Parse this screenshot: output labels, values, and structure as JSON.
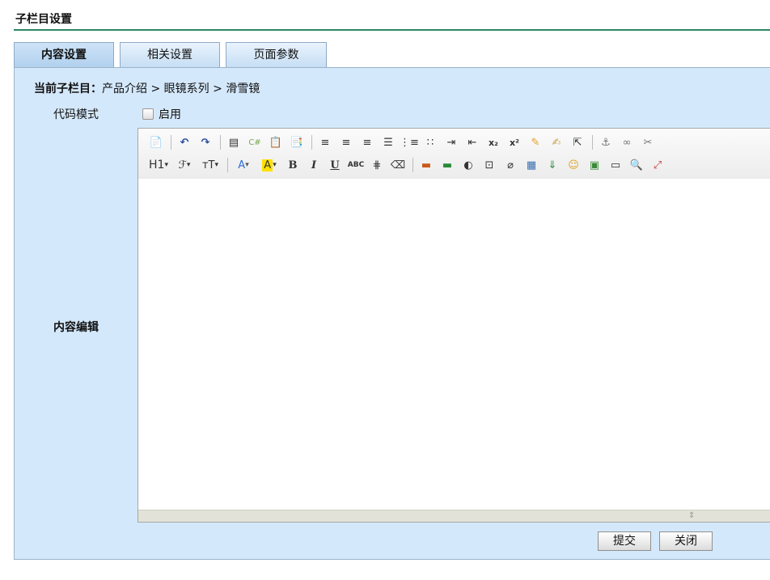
{
  "page": {
    "title": "子栏目设置"
  },
  "tabs": [
    {
      "label": "内容设置",
      "active": true
    },
    {
      "label": "相关设置",
      "active": false
    },
    {
      "label": "页面参数",
      "active": false
    }
  ],
  "breadcrumb": {
    "label": "当前子栏目：",
    "items": [
      "产品介绍",
      "眼镜系列",
      "滑雪镜"
    ],
    "separator": ">"
  },
  "code_mode": {
    "label": "代码模式",
    "checkbox_label": "启用",
    "checked": false
  },
  "content_editor": {
    "label": "内容编辑",
    "value": ""
  },
  "toolbar": {
    "row1": [
      "source",
      "undo",
      "redo",
      "|",
      "paste-text",
      "code",
      "paste",
      "paste-word",
      "|",
      "align-left",
      "align-center",
      "align-right",
      "justify",
      "ordered-list",
      "unordered-list",
      "indent",
      "outdent",
      "subscript",
      "superscript",
      "clear-format",
      "format-painter",
      "select-all",
      "|",
      "anchor",
      "link",
      "unlink"
    ],
    "row2": [
      "heading",
      "font-family",
      "font-size",
      "|",
      "font-color",
      "highlight-color",
      "bold",
      "italic",
      "underline",
      "strikethrough",
      "horizontal-rule",
      "eraser",
      "|",
      "insert-image",
      "insert-images",
      "flash",
      "media",
      "attachment",
      "table",
      "insert-code",
      "emoticon",
      "image",
      "page-break",
      "preview",
      "fullscreen"
    ],
    "labels": {
      "heading": "H1",
      "bold": "B",
      "italic": "I",
      "underline": "U",
      "strikethrough": "ABC",
      "subscript": "x₂",
      "superscript": "x²"
    }
  },
  "actions": {
    "submit_label": "提交",
    "close_label": "关闭"
  },
  "colors": {
    "accent": "#2a8a62",
    "panel": "#d4e8fb"
  }
}
